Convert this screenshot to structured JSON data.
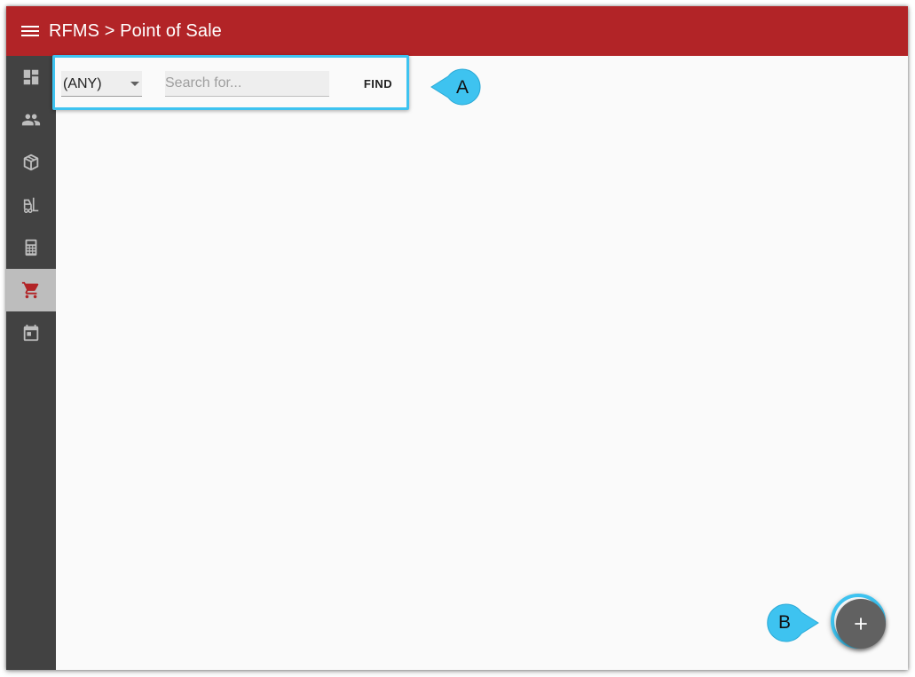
{
  "header": {
    "title": "RFMS > Point of Sale",
    "menu_icon": "hamburger-menu-icon",
    "background_color": "#b22427"
  },
  "sidebar": {
    "background_color": "#424242",
    "items": [
      {
        "name": "dashboard",
        "icon": "dashboard-icon",
        "active": false
      },
      {
        "name": "customers",
        "icon": "people-icon",
        "active": false
      },
      {
        "name": "products",
        "icon": "package-icon",
        "active": false
      },
      {
        "name": "warehouse",
        "icon": "forklift-icon",
        "active": false
      },
      {
        "name": "calculator",
        "icon": "calculator-icon",
        "active": false
      },
      {
        "name": "point-of-sale",
        "icon": "shopping-cart-icon",
        "active": true
      },
      {
        "name": "calendar",
        "icon": "calendar-icon",
        "active": false
      }
    ],
    "active_color": "#b22427"
  },
  "search": {
    "filter_value": "(ANY)",
    "placeholder": "Search for...",
    "query_value": "",
    "find_label": "FIND"
  },
  "callouts": {
    "a_label": "A",
    "b_label": "B",
    "color": "#3ec3f0"
  },
  "fab": {
    "icon": "plus-icon",
    "color": "#616161"
  }
}
